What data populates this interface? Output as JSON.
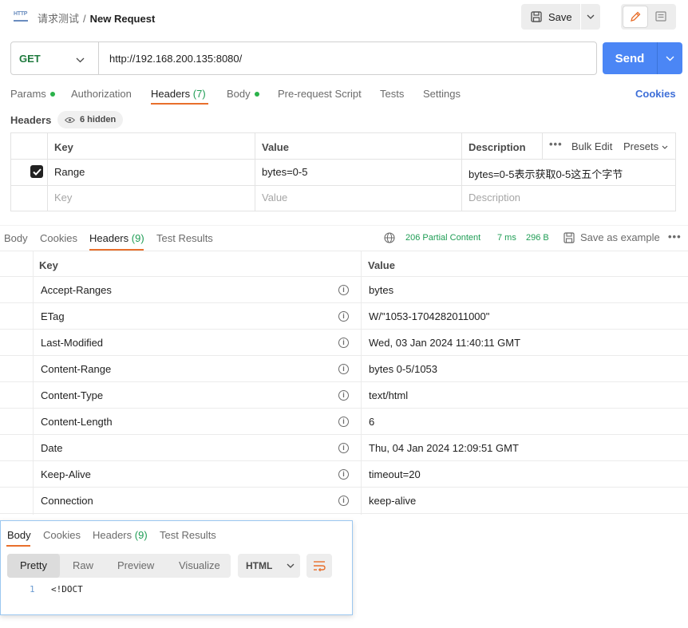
{
  "header": {
    "icon_label": "HTTP",
    "collection": "请求测试",
    "separator": "/",
    "request_name": "New Request",
    "save_label": "Save"
  },
  "url_bar": {
    "method": "GET",
    "url": "http://192.168.200.135:8080/",
    "send_label": "Send"
  },
  "request_tabs": [
    {
      "label": "Params",
      "dot": true
    },
    {
      "label": "Authorization"
    },
    {
      "label": "Headers",
      "count": "(7)",
      "active": true
    },
    {
      "label": "Body",
      "dot": true
    },
    {
      "label": "Pre-request Script"
    },
    {
      "label": "Tests"
    },
    {
      "label": "Settings"
    }
  ],
  "cookies_link": "Cookies",
  "headers_section": {
    "title": "Headers",
    "hidden_label": "6 hidden",
    "columns": {
      "key": "Key",
      "value": "Value",
      "description": "Description"
    },
    "bulk_edit": "Bulk Edit",
    "presets": "Presets",
    "rows": [
      {
        "checked": true,
        "key": "Range",
        "value": "bytes=0-5",
        "description": "bytes=0-5表示获取0-5这五个字节"
      }
    ],
    "placeholder": {
      "key": "Key",
      "value": "Value",
      "description": "Description"
    }
  },
  "response_tabs": [
    {
      "label": "Body"
    },
    {
      "label": "Cookies"
    },
    {
      "label": "Headers",
      "count": "(9)",
      "active": true
    },
    {
      "label": "Test Results"
    }
  ],
  "response_meta": {
    "status": "206 Partial Content",
    "time": "7 ms",
    "size": "296 B",
    "save_example": "Save as example"
  },
  "response_headers": {
    "columns": {
      "key": "Key",
      "value": "Value"
    },
    "rows": [
      {
        "key": "Accept-Ranges",
        "value": "bytes"
      },
      {
        "key": "ETag",
        "value": "W/\"1053-1704282011000\""
      },
      {
        "key": "Last-Modified",
        "value": "Wed, 03 Jan 2024 11:40:11 GMT"
      },
      {
        "key": "Content-Range",
        "value": "bytes 0-5/1053"
      },
      {
        "key": "Content-Type",
        "value": "text/html"
      },
      {
        "key": "Content-Length",
        "value": "6"
      },
      {
        "key": "Date",
        "value": "Thu, 04 Jan 2024 12:09:51 GMT"
      },
      {
        "key": "Keep-Alive",
        "value": "timeout=20"
      },
      {
        "key": "Connection",
        "value": "keep-alive"
      }
    ]
  },
  "popup": {
    "tabs": [
      {
        "label": "Body",
        "active": true
      },
      {
        "label": "Cookies"
      },
      {
        "label": "Headers",
        "count": "(9)"
      },
      {
        "label": "Test Results"
      }
    ],
    "view_modes": [
      "Pretty",
      "Raw",
      "Preview",
      "Visualize"
    ],
    "format": "HTML",
    "code": [
      {
        "line": "1",
        "text": "<!DOCT"
      }
    ]
  }
}
